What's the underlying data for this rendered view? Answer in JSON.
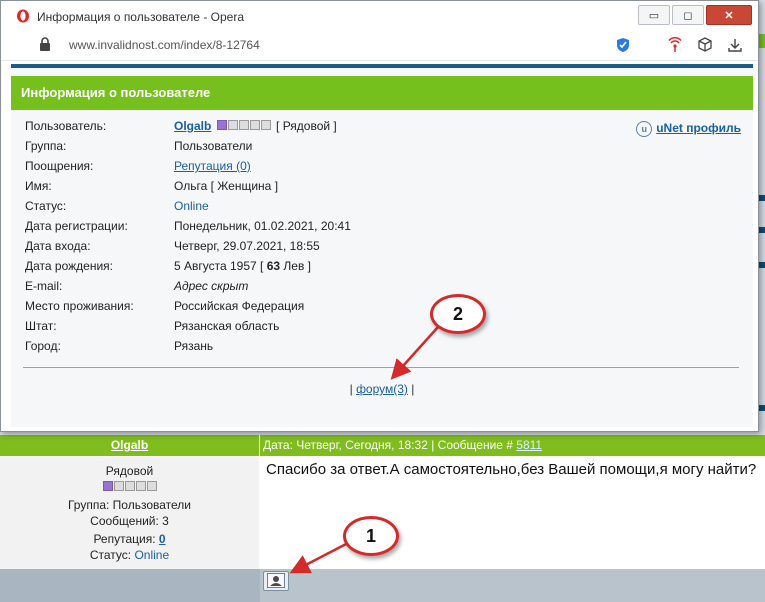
{
  "window": {
    "title": "Информация о пользователе - Opera",
    "url": "www.invalidnost.com/index/8-12764",
    "buttons": {
      "minimize": "▭",
      "maximize": "◻",
      "close": "✕"
    }
  },
  "profile": {
    "header": "Информация о пользователе",
    "unet_label": "uNet профиль",
    "rows": [
      {
        "label": "Пользователь:",
        "value": "Olgalb",
        "rank": "[ Рядовой ]"
      },
      {
        "label": "Группа:",
        "value": "Пользователи"
      },
      {
        "label": "Поощрения:",
        "value": "Репутация (0)"
      },
      {
        "label": "Имя:",
        "value": "Ольга [ Женщина ]"
      },
      {
        "label": "Статус:",
        "value": "Online"
      },
      {
        "label": "Дата регистрации:",
        "value": "Понедельник, 01.02.2021, 20:41"
      },
      {
        "label": "Дата входа:",
        "value": "Четверг, 29.07.2021, 18:55"
      },
      {
        "label": "Дата рождения:",
        "value_prefix": "5 Августа 1957 [ ",
        "value_bold": "63",
        "value_suffix": " Лев ]"
      },
      {
        "label": "E-mail:",
        "value": "Адрес скрыт"
      },
      {
        "label": "Место проживания:",
        "value": "Российская Федерация"
      },
      {
        "label": "Штат:",
        "value": "Рязанская область"
      },
      {
        "label": "Город:",
        "value": "Рязань"
      }
    ],
    "forum_prefix": "| ",
    "forum_link": "форум(3)",
    "forum_suffix": " |"
  },
  "post": {
    "author": "Olgalb",
    "meta_prefix": "Дата: Четверг, Сегодня, 18:32 | Сообщение # ",
    "message_number": "5811",
    "rank": "Рядовой",
    "group": "Группа: Пользователи",
    "messages": "Сообщений: 3",
    "reputation_label": "Репутация: ",
    "reputation_value": "0",
    "status_label": "Статус: ",
    "status_value": "Online",
    "text": "Спасибо за ответ.А самостоятельно,без Вашей помощи,я могу найти?"
  },
  "callouts": {
    "one": "1",
    "two": "2"
  },
  "colors": {
    "green": "#76c01e",
    "link": "#1a5fa8",
    "annotation": "#d42a2a"
  }
}
